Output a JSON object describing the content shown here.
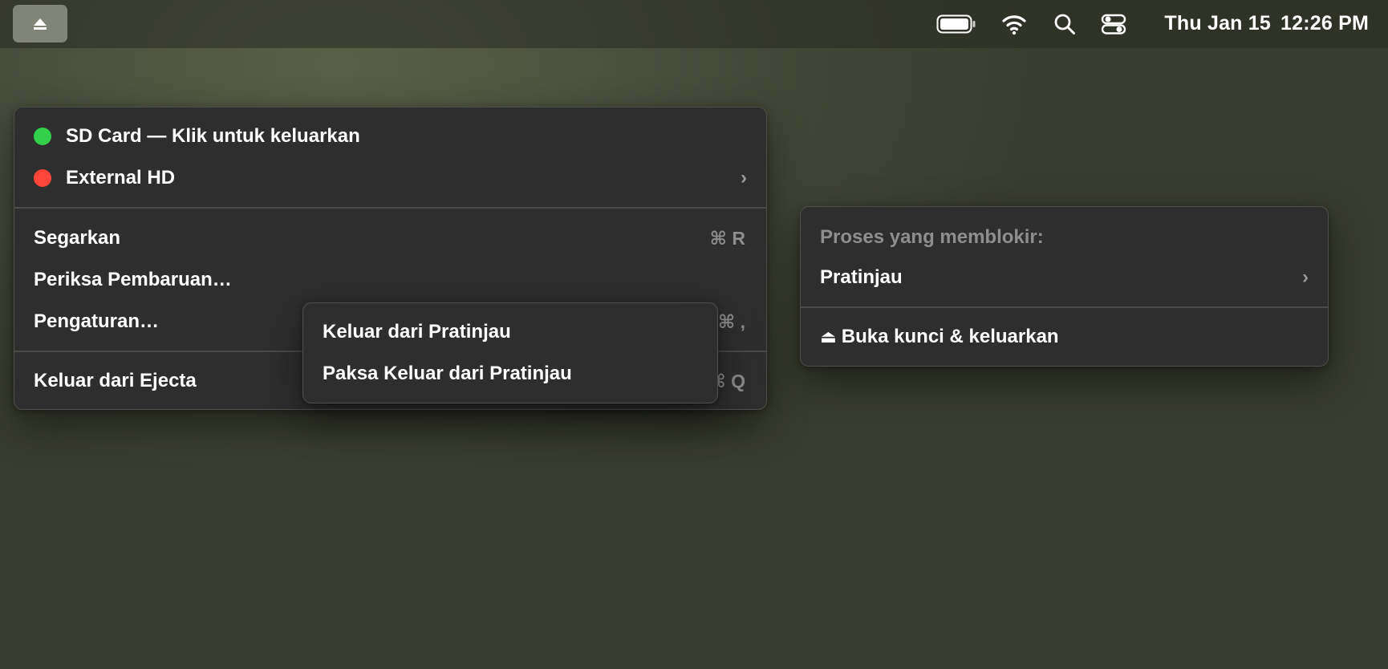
{
  "menubar": {
    "clock": {
      "date": "Thu Jan 15",
      "time": "12:26 PM"
    },
    "icons": [
      "eject-icon",
      "battery-icon",
      "wifi-icon",
      "search-icon",
      "control-center-icon"
    ]
  },
  "main_menu": {
    "disks": [
      {
        "label": "SD Card — Klik untuk keluarkan",
        "status_color": "#32d04b"
      },
      {
        "label": "External HD",
        "status_color": "#ff453a",
        "submenu_glyph": "›"
      }
    ],
    "actions": [
      {
        "label": "Segarkan",
        "shortcut": "⌘ R"
      },
      {
        "label": "Periksa Pembaruan…",
        "shortcut": ""
      },
      {
        "label": "Pengaturan…",
        "shortcut": "⌘ ,"
      }
    ],
    "quit": {
      "label": "Keluar dari Ejecta",
      "shortcut": "⌘ Q"
    }
  },
  "process_submenu": {
    "items": [
      {
        "label": "Keluar dari Pratinjau"
      },
      {
        "label": "Paksa Keluar dari Pratinjau"
      }
    ]
  },
  "blocking_menu": {
    "header": "Proses yang memblokir:",
    "process": {
      "label": "Pratinjau",
      "submenu_glyph": "›"
    },
    "unlock": {
      "icon": "⏏",
      "label": "Buka kunci & keluarkan"
    }
  }
}
